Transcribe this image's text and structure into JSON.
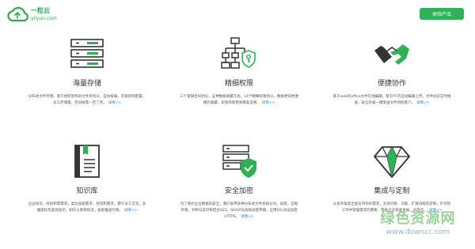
{
  "header": {
    "logo_name": "一粒云",
    "logo_domain": "yliyun.com",
    "cta_label": "体验产品"
  },
  "features": [
    {
      "icon": "server-storage-icon",
      "title": "海量存储",
      "desc": "分布式文件存储，基于组织架构的文件夹划分，自动排编，丰富权限配置，员工存储量，空间按需一百了然。",
      "more": "详情>>"
    },
    {
      "icon": "permission-tree-icon",
      "title": "精细权限",
      "desc": "三个逻辑合同划分，五种数据收藏方式，14个精细权限划分，数据更快更便捷的收藏，权限场景更易精准追溯。",
      "more": "详情>>"
    },
    {
      "icon": "handshake-icon",
      "title": "便捷协作",
      "desc": "基于web的office文件在线编辑，基于PC的自动编辑上传，文件动态实时推送，安全升级一键发送文件到他客户。",
      "more": "详情>>"
    },
    {
      "icon": "book-icon",
      "title": "知识库",
      "desc": "企业知识，经验积累需求，类比技能需求，经验和需求，便于员工交流，多维度标签查找知识，知识入库审核流，类即推送行情。",
      "more": "详情>>"
    },
    {
      "icon": "security-shield-icon",
      "title": "安全加密",
      "desc": "为了保护企业数据的安全，我们采用多种分布式文件系统分块，加密，压缩存储，对称与非对称结合AES，SHA256高级加密传输，应用SSL协议加密HTTPS。",
      "more": "详情>>"
    },
    {
      "icon": "diamond-icon",
      "title": "集成与定制",
      "desc": "从技术角度出发支持你的需求，支持对接，功能、扩展功能的定制，针对现工作中管理需求的需要，帮助企业快速发展，去改造。",
      "more": "详情>>"
    }
  ],
  "watermark": {
    "name": "绿色资源网",
    "url": "www.downcc.com"
  }
}
